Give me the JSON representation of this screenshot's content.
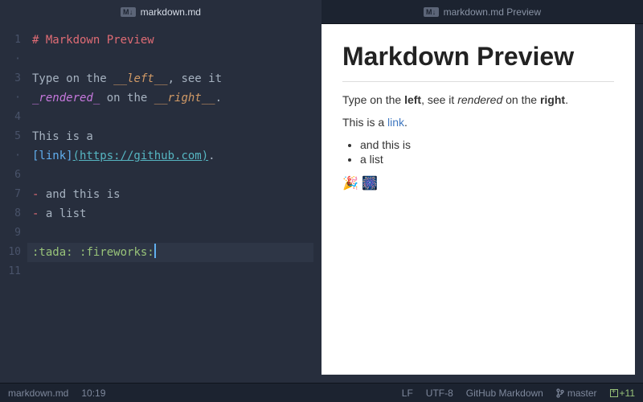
{
  "tabs": {
    "editor": {
      "badge": "M↓",
      "label": "markdown.md"
    },
    "preview": {
      "badge": "M↓",
      "label": "markdown.md Preview"
    }
  },
  "gutter": [
    "1",
    "·",
    "3",
    "·",
    "4",
    "5",
    "·",
    "6",
    "7",
    "8",
    "9",
    "10",
    "11"
  ],
  "code": {
    "l1_head": "# Markdown Preview",
    "l3_a": "Type on the ",
    "l3_b": "__left__",
    "l3_c": ", see it",
    "l4_a": "_rendered_",
    "l4_b": " on the ",
    "l4_c": "__right__",
    "l4_d": ".",
    "l6": "This is a",
    "l7_a": "[link]",
    "l7_b": "(https://github.com)",
    "l7_c": ".",
    "l9_a": "- ",
    "l9_b": "and this is",
    "l10_a": "- ",
    "l10_b": "a list",
    "l12_a": ":tada:",
    "l12_b": " ",
    "l12_c": ":fireworks:"
  },
  "preview": {
    "h1": "Markdown Preview",
    "p1_a": "Type on the ",
    "p1_b": "left",
    "p1_c": ", see it ",
    "p1_d": "rendered",
    "p1_e": " on the ",
    "p1_f": "right",
    "p1_g": ".",
    "p2_a": "This is a ",
    "p2_link": "link",
    "p2_b": ".",
    "li1": "and this is",
    "li2": "a list",
    "emoji": "🎉 🎆"
  },
  "status": {
    "file": "markdown.md",
    "pos": "10:19",
    "eol": "LF",
    "enc": "UTF-8",
    "grammar": "GitHub Markdown",
    "branch": "master",
    "diff": "+11"
  },
  "colors": {
    "bg": "#272e3d",
    "chrome": "#1c2330",
    "link": "#4078c0"
  }
}
